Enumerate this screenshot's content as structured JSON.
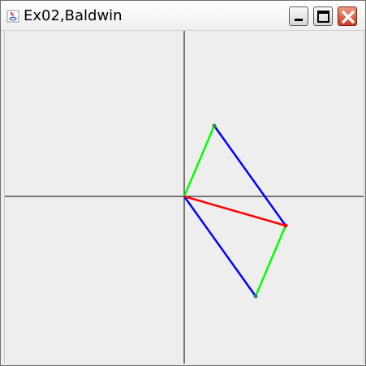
{
  "window": {
    "title": "Ex02,Baldwin"
  },
  "icons": {
    "app": "java-app-icon",
    "minimize": "minimize-icon",
    "maximize": "maximize-icon",
    "close": "close-icon"
  },
  "colors": {
    "red_vector": "#ff0000",
    "green_vector": "#00ff00",
    "blue_vector": "#0000ff",
    "axes": "#000000",
    "background": "#eeeeee"
  }
}
